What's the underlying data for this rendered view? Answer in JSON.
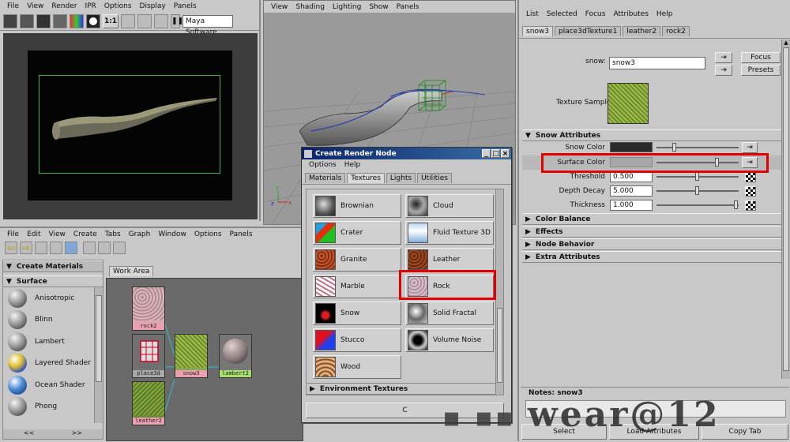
{
  "render_view": {
    "menu": [
      "File",
      "View",
      "Render",
      "IPR",
      "Options",
      "Display",
      "Panels"
    ],
    "renderer": "Maya Software",
    "ratio": "1:1"
  },
  "viewport": {
    "menu": [
      "View",
      "Shading",
      "Lighting",
      "Show",
      "Panels"
    ]
  },
  "hypershade": {
    "menu": [
      "File",
      "Edit",
      "View",
      "Create",
      "Tabs",
      "Graph",
      "Window",
      "Options",
      "Panels"
    ],
    "create_materials_label": "Create Materials",
    "surface_label": "Surface",
    "materials": [
      "Anisotropic",
      "Blinn",
      "Lambert",
      "Layered Shader",
      "Ocean Shader",
      "Phong"
    ],
    "bottom_left": "<<",
    "bottom_right": ">>",
    "work_area_tab": "Work Area",
    "nodes": {
      "rock": "rock2",
      "place": "place3d",
      "snow": "snow3",
      "lambert": "lambert2",
      "leather": "leather2"
    }
  },
  "create_render_node": {
    "title": "Create Render Node",
    "menu": [
      "Options",
      "Help"
    ],
    "tabs": [
      "Materials",
      "Textures",
      "Lights",
      "Utilities"
    ],
    "selected_tab": "Textures",
    "textures_left": [
      "Brownian",
      "Crater",
      "Granite",
      "Marble",
      "Snow",
      "Stucco",
      "Wood"
    ],
    "textures_right": [
      "Cloud",
      "Fluid Texture 3D",
      "Leather",
      "Rock",
      "Solid Fractal",
      "Volume Noise"
    ],
    "env_section": "Environment Textures",
    "close_label": "C"
  },
  "attribute_editor": {
    "menu": [
      "List",
      "Selected",
      "Focus",
      "Attributes",
      "Help"
    ],
    "tabs": [
      "snow3",
      "place3dTexture1",
      "leather2",
      "rock2"
    ],
    "node_label": "snow:",
    "node_value": "snow3",
    "focus_label": "Focus",
    "presets_label": "Presets",
    "texture_sample_label": "Texture Sample",
    "section_snow": "Snow Attributes",
    "snow_color_label": "Snow Color",
    "surface_color_label": "Surface Color",
    "threshold_label": "Threshold",
    "threshold_value": "0.500",
    "depth_decay_label": "Depth Decay",
    "depth_decay_value": "5.000",
    "thickness_label": "Thickness",
    "thickness_value": "1.000",
    "slider_levels": {
      "snow_color": 0.2,
      "surface_color": 0.75,
      "threshold": 0.5,
      "depth_decay": 0.5,
      "thickness": 1.0
    },
    "sections_collapsed": [
      "Color Balance",
      "Effects",
      "Node Behavior",
      "Extra Attributes"
    ],
    "notes_label": "Notes:  snow3",
    "select_label": "Select",
    "load_label": "Load Attributes",
    "copy_label": "Copy Tab"
  },
  "watermark": "wear@12",
  "colors": {
    "highlight_box": "#e00000",
    "snow_color": "#2a2a2a",
    "surface_color": "#a8a8a8"
  }
}
